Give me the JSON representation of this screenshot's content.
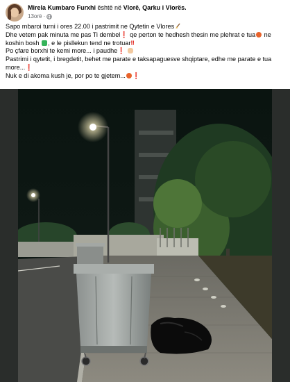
{
  "post": {
    "author": "Mirela Kumbaro Furxhi",
    "is_in": "është në",
    "location": "Vlorë, Qarku i Vlorës.",
    "time": "13orë",
    "privacy_icon": "globe-icon",
    "lines": {
      "l1": "Sapo mbaroi turni i ores 22.00 i pastrimit ne Qytetin e Vlores",
      "l2a": "Dhe vetem pak minuta me pas Ti dembel",
      "l2b": " qe perton te hedhesh thesin me plehrat e tua",
      "l2c": " ne",
      "l3a": "koshin bosh",
      "l3b": ", e le pisllekun tend ne trotuar",
      "l4a": "Po çfare borxhi te kemi more... i paudhe",
      "l5": "Pastrimi i qytetit, i bregdetit, behet me parate e taksapaguesve shqiptare, edhe me parate e tua",
      "l6": "more...",
      "l7": "Nuk e di akoma kush je, por po te gjetem...",
      "bang1": "❗",
      "bang2": "‼",
      "bang3": "❗",
      "bang4": "❗",
      "bang5": "❗"
    }
  },
  "colors": {
    "text": "#050505",
    "secondary": "#65676b",
    "alert": "#e0231c"
  }
}
